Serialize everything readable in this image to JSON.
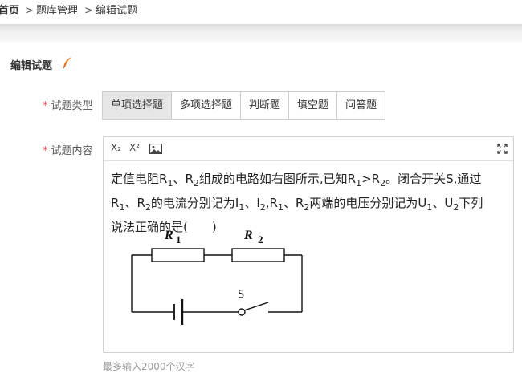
{
  "breadcrumb": {
    "home": "首页",
    "separator": ">",
    "level1": "题库管理",
    "level2": "编辑试题"
  },
  "section": {
    "title": "编辑试题"
  },
  "form": {
    "type_label": "试题类型",
    "required_mark": "*",
    "type_tabs": [
      "单项选择题",
      "多项选择题",
      "判断题",
      "填空题",
      "问答题"
    ],
    "content_label": "试题内容",
    "toolbar": {
      "subscript": "X₂",
      "superscript": "X²"
    },
    "question": {
      "p1a": "定值电阻R",
      "p1b": "、R",
      "p1c": "组成的电路如右图所示,已知R",
      "p1d": ">R",
      "p1e": "。闭合开关S,通过",
      "p2a": "R",
      "p2b": "、R",
      "p2c": "的电流分别记为I",
      "p2d": "、I",
      "p2e": ",R",
      "p2f": "、R",
      "p2g": "两端的电压分别记为U",
      "p2h": "、U",
      "p2i": "下列",
      "p3": "说法正确的是(　　)",
      "sub1": "1",
      "sub2": "2"
    },
    "circuit": {
      "r1": "R",
      "r1_sub": "1",
      "r2": "R",
      "r2_sub": "2",
      "switch": "S"
    },
    "hint": "最多输入2000个汉字"
  },
  "colors": {
    "required": "#e4393c",
    "active_tab": "#e6e6e6",
    "accent_icon": "#f07c1e"
  }
}
